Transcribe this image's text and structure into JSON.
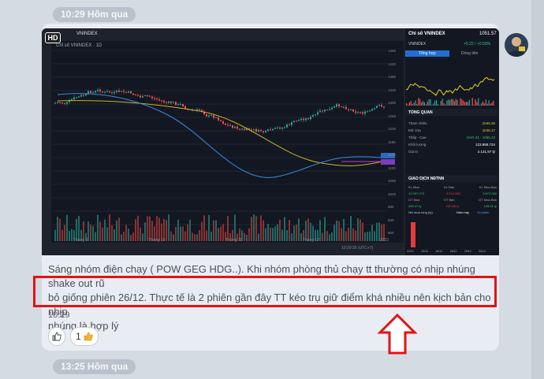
{
  "date_dividers": {
    "top": "10:29 Hôm qua",
    "bottom": "13:25 Hôm qua"
  },
  "message": {
    "lines": [
      "Sáng nhóm điện chạy ( POW GEG HDG..). Khi nhóm phòng thủ chạy tt thường có nhịp nhúng shake out rũ",
      "bỏ giống phiên 26/12. Thực tế là 2 phiên gần đây TT kéo trụ giữ điểm khá nhiều nên kịch bản cho nhịp",
      "nhúng là hợp lý"
    ],
    "time": "10:29",
    "reactions": {
      "like_icon": "thumbs-up-icon",
      "count": "1",
      "emoji_icon": "thumbs-up-emoji"
    }
  },
  "screenshot": {
    "hd_badge": "HD",
    "ticker": "VNINDEX",
    "chart_title": "Chỉ số VNINDEX · 1D",
    "panel_title": "Chỉ số VNINDEX",
    "panel_value": "1051.57",
    "panel_ticker": "VNINDEX",
    "panel_change": "+5.22 / +0.50%",
    "tabs": [
      "Tổng hợp",
      "Dòng tiền"
    ],
    "overview_title": "TỔNG QUAN",
    "overview_rows": [
      {
        "label": "Tham chiếu",
        "value": "1046.35"
      },
      {
        "label": "Mở cửa",
        "value": "1046.17"
      },
      {
        "label": "Thấp - Cao",
        "value": "1047.41 - 1055.23"
      },
      {
        "label": "Khối lượng",
        "value": "123.868.734"
      },
      {
        "label": "Giá trị",
        "value": "2.131,97 tỷ"
      }
    ],
    "foreign_title": "GIAO DỊCH NĐTNN",
    "foreign_headers": [
      "KL Mua",
      "KL Bán",
      "KL Mua-Bán"
    ],
    "foreign_values": [
      "12.097.073",
      "8.214.850",
      "3.872.000"
    ],
    "foreign_headers2": [
      "GT Mua",
      "GT Bán",
      "GT Mua-Bán"
    ],
    "foreign_values2": [
      "289.47 tỷ",
      "230.86 tỷ",
      "128.61 tỷ"
    ],
    "netbuy_label": "NN mua ròng (tỷ)",
    "netbuy_tabs": [
      "Hôm nay",
      "10 phiên"
    ],
    "netbuy_dates": [
      "22/12",
      "23/12",
      "26/12",
      "28/12",
      "29/12",
      "30/12"
    ],
    "time_axis": [
      "Tháng 9",
      "Tháng 10",
      "Tháng 11",
      "Tháng 12",
      "2023"
    ],
    "price_axis": [
      "1460",
      "1420",
      "1380",
      "1340",
      "1300",
      "1260",
      "1220",
      "1180",
      "1140",
      "1100",
      "1060",
      "1020",
      "980",
      "940",
      "900"
    ],
    "clock": "10:29:35 (UTC+7)"
  }
}
